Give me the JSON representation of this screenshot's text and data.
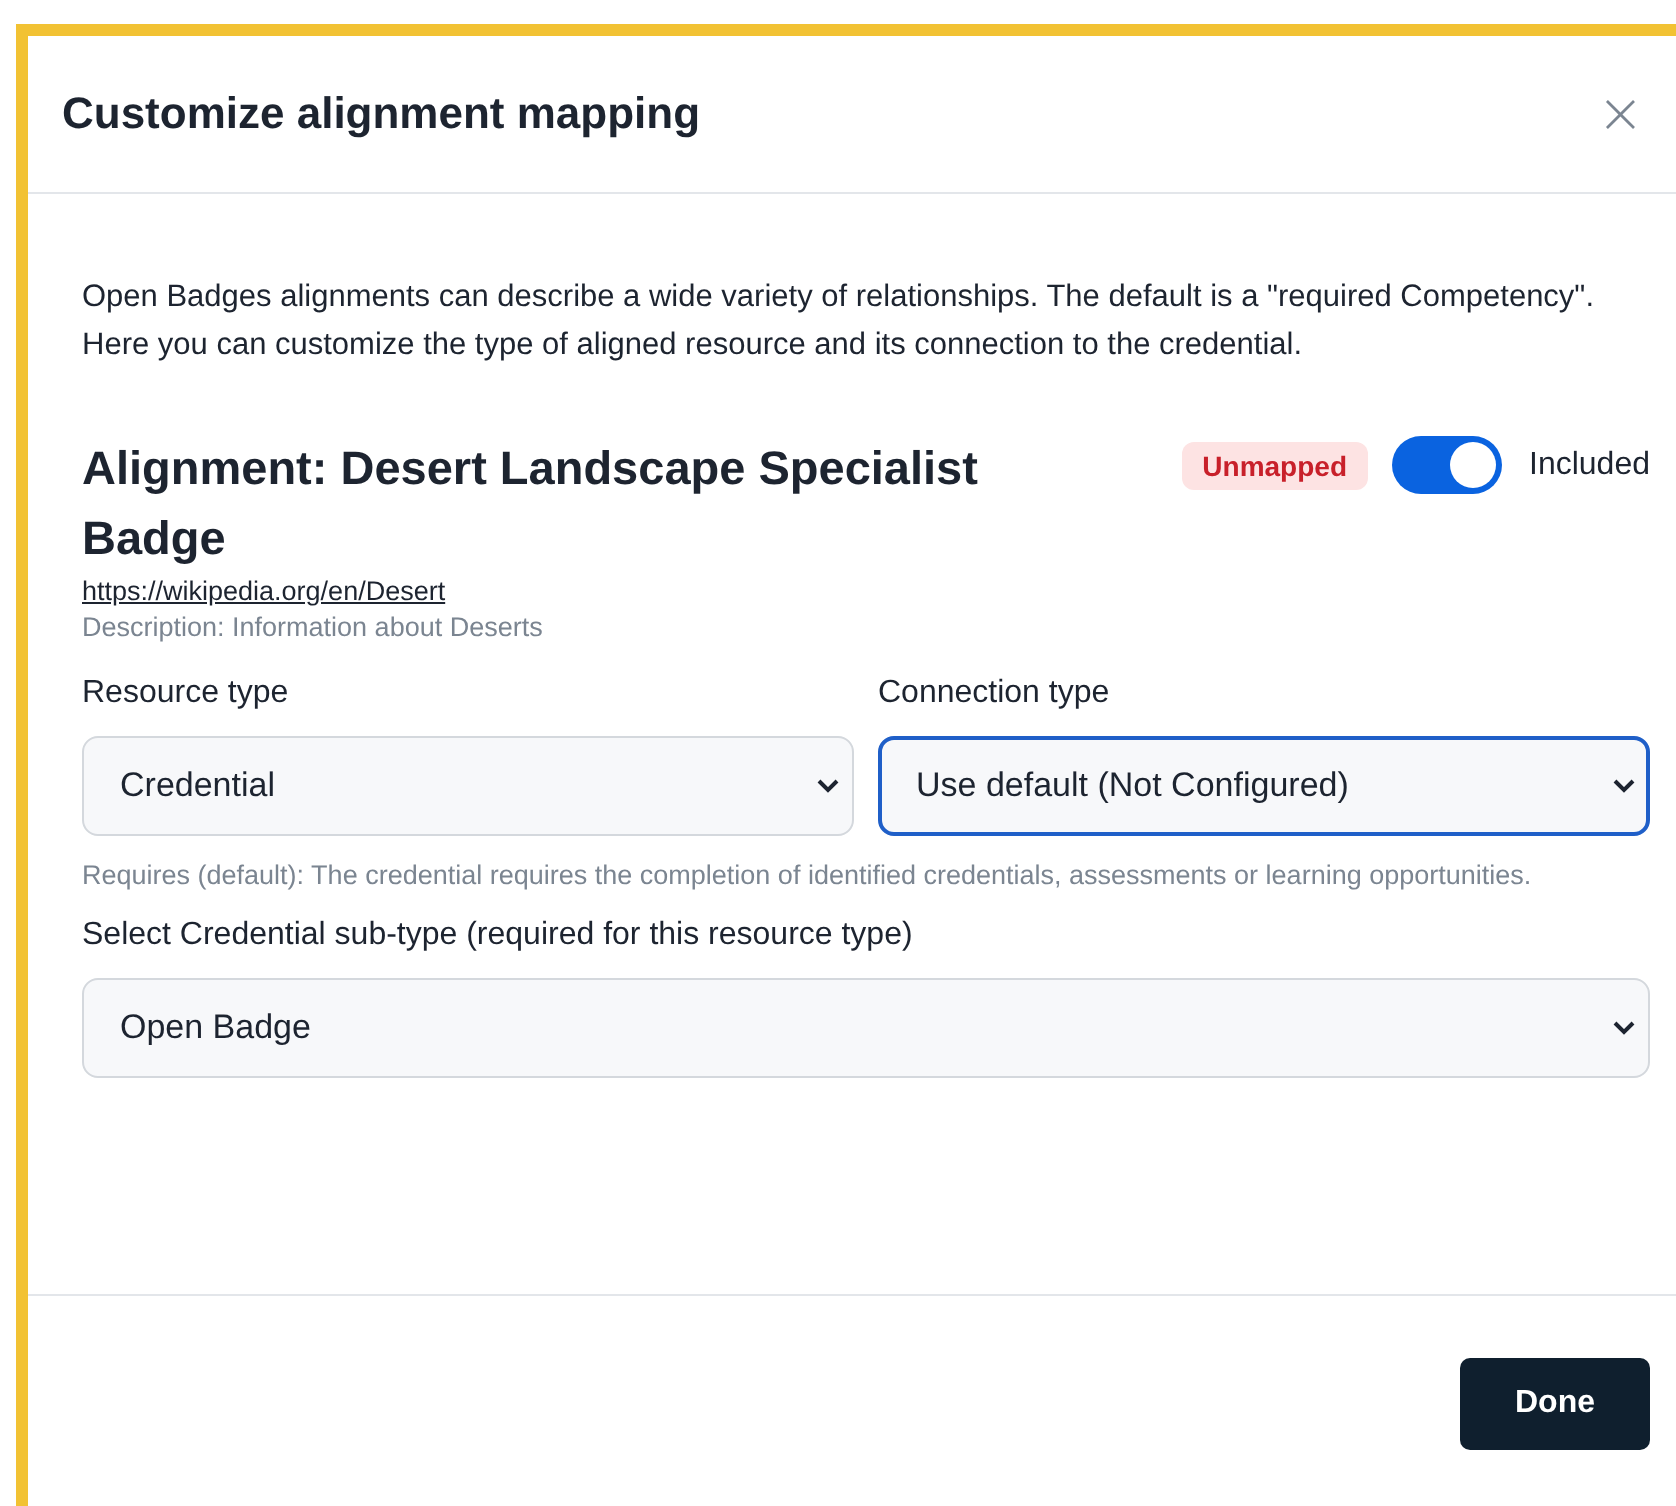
{
  "dialog": {
    "title": "Customize alignment mapping",
    "close": "×"
  },
  "intro": "Open Badges alignments can describe a wide variety of relationships. The default is a \"required Competency\". Here you can customize the type of aligned resource and its connection to the credential.",
  "alignment": {
    "title": "Alignment: Desert Landscape Specialist Badge",
    "url": "https://wikipedia.org/en/Desert",
    "description": "Description: Information about Deserts",
    "status": "Unmapped",
    "included": {
      "label": "Included",
      "on": true
    }
  },
  "fields": [
    {
      "label": "Resource type",
      "value": "Credential",
      "focused": false
    },
    {
      "label": "Connection type",
      "value": "Use default (Not Configured)",
      "focused": true
    }
  ],
  "help": "Requires (default): The credential requires the completion of identified credentials, assessments or learning opportunities.",
  "subtype": {
    "label": "Select Credential sub-type (required for this resource type)",
    "value": "Open Badge",
    "focused": false
  },
  "buttons": [
    {
      "label": "Done"
    }
  ]
}
